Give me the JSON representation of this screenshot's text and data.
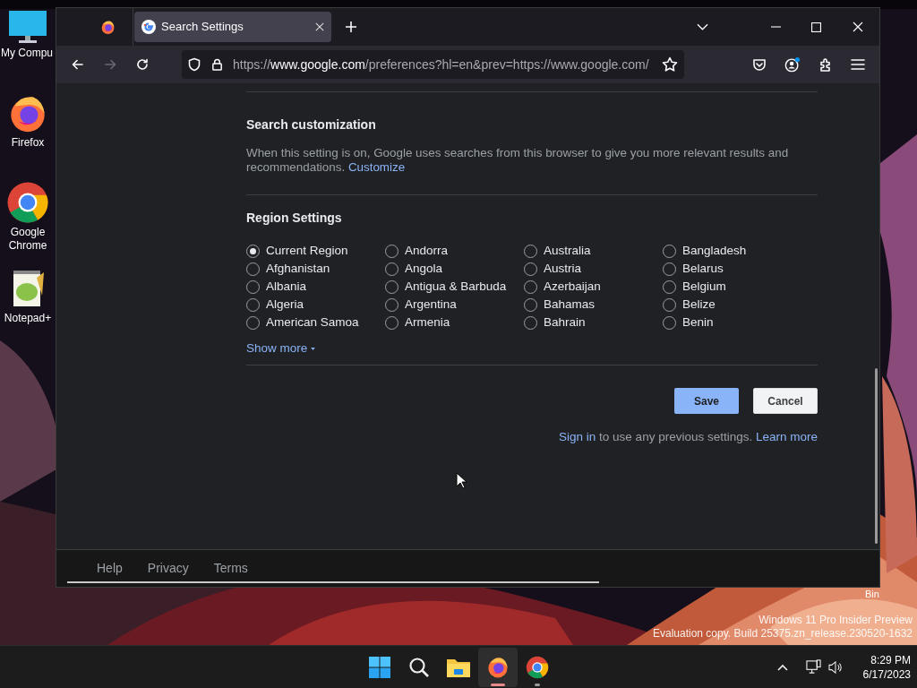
{
  "desktop": {
    "icons": [
      {
        "kind": "computer",
        "label": "My Compu"
      },
      {
        "kind": "firefox",
        "label": "Firefox"
      },
      {
        "kind": "chrome",
        "label": "Google Chrome"
      },
      {
        "kind": "notepad",
        "label": "Notepad+"
      }
    ],
    "recycle_bin": {
      "label": "Bin"
    },
    "watermark": [
      "Windows 11 Pro Insider Preview",
      "Evaluation copy. Build 25375.zn_release.230520-1632"
    ]
  },
  "browser": {
    "tabs": [
      {
        "title": "Search Settings",
        "selected": true
      }
    ],
    "nav_buttons": [
      {
        "kind": "back",
        "disabled": false
      },
      {
        "kind": "forward",
        "disabled": true
      },
      {
        "kind": "reload",
        "disabled": false
      }
    ],
    "url": {
      "scheme": "https://",
      "host": "www.google.com",
      "rest": "/preferences?hl=en&prev=https://www.google.com/"
    }
  },
  "page": {
    "search_customization": {
      "title": "Search customization",
      "text": "When this setting is on, Google uses searches from this browser to give you more relevant results and recommendations.",
      "link": "Customize"
    },
    "region_settings": {
      "title": "Region Settings",
      "options": [
        {
          "label": "Current Region",
          "selected": true
        },
        {
          "label": "Afghanistan",
          "selected": false
        },
        {
          "label": "Albania",
          "selected": false
        },
        {
          "label": "Algeria",
          "selected": false
        },
        {
          "label": "American Samoa",
          "selected": false
        },
        {
          "label": "Andorra",
          "selected": false
        },
        {
          "label": "Angola",
          "selected": false
        },
        {
          "label": "Antigua & Barbuda",
          "selected": false
        },
        {
          "label": "Argentina",
          "selected": false
        },
        {
          "label": "Armenia",
          "selected": false
        },
        {
          "label": "Australia",
          "selected": false
        },
        {
          "label": "Austria",
          "selected": false
        },
        {
          "label": "Azerbaijan",
          "selected": false
        },
        {
          "label": "Bahamas",
          "selected": false
        },
        {
          "label": "Bahrain",
          "selected": false
        },
        {
          "label": "Bangladesh",
          "selected": false
        },
        {
          "label": "Belarus",
          "selected": false
        },
        {
          "label": "Belgium",
          "selected": false
        },
        {
          "label": "Belize",
          "selected": false
        },
        {
          "label": "Benin",
          "selected": false
        }
      ],
      "show_more": "Show more"
    },
    "buttons": [
      {
        "kind": "primary",
        "label": "Save"
      },
      {
        "kind": "secondary",
        "label": "Cancel"
      }
    ],
    "sign_in": {
      "link": "Sign in",
      "text": "to use any previous settings.",
      "learn_more": "Learn more"
    },
    "footer": [
      "Help",
      "Privacy",
      "Terms"
    ]
  },
  "taskbar": {
    "apps": [
      {
        "kind": "start",
        "active": false
      },
      {
        "kind": "search",
        "active": false
      },
      {
        "kind": "files",
        "active": false
      },
      {
        "kind": "firefox",
        "active": true
      },
      {
        "kind": "chrome",
        "active": false
      }
    ],
    "time": "8:29 PM",
    "date": "6/17/2023"
  }
}
